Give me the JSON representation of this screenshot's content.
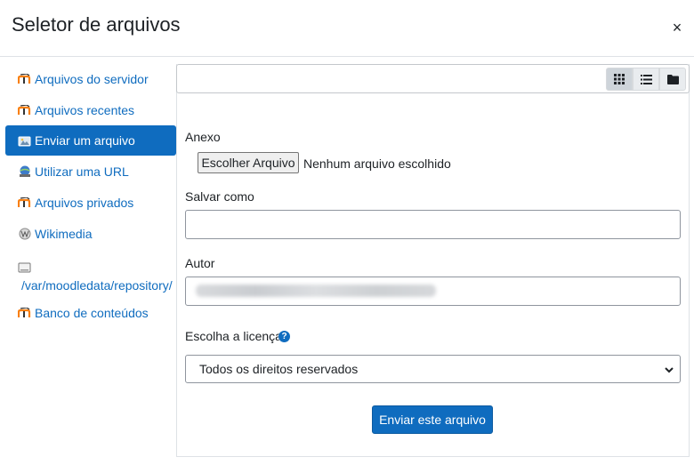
{
  "dialog": {
    "title": "Seletor de arquivos",
    "close_label": "×"
  },
  "sidebar": {
    "items": [
      {
        "label": "Arquivos do servidor",
        "icon": "moodle-icon"
      },
      {
        "label": "Arquivos recentes",
        "icon": "moodle-icon"
      },
      {
        "label": "Enviar um arquivo",
        "icon": "upload-icon",
        "active": true
      },
      {
        "label": "Utilizar uma URL",
        "icon": "url-icon"
      },
      {
        "label": "Arquivos privados",
        "icon": "moodle-icon"
      },
      {
        "label": "Wikimedia",
        "icon": "wikimedia-icon"
      },
      {
        "label": "/var/moodledata/repository/",
        "icon": "filesystem-icon"
      },
      {
        "label": "Banco de conteúdos",
        "icon": "moodle-icon"
      }
    ]
  },
  "toolbar": {
    "views": [
      "grid-view-icon",
      "list-view-icon",
      "folder-view-icon"
    ],
    "active_view": "grid-view-icon"
  },
  "form": {
    "attachment_label": "Anexo",
    "choose_file_button": "Escolher Arquivo",
    "file_status": "Nenhum arquivo escolhido",
    "save_as_label": "Salvar como",
    "save_as_value": "",
    "author_label": "Autor",
    "license_label": "Escolha a licença",
    "license_selected": "Todos os direitos reservados",
    "submit_label": "Enviar este arquivo"
  },
  "colors": {
    "accent": "#0f6cbf",
    "text": "#1d2125",
    "border": "#8f959e"
  }
}
